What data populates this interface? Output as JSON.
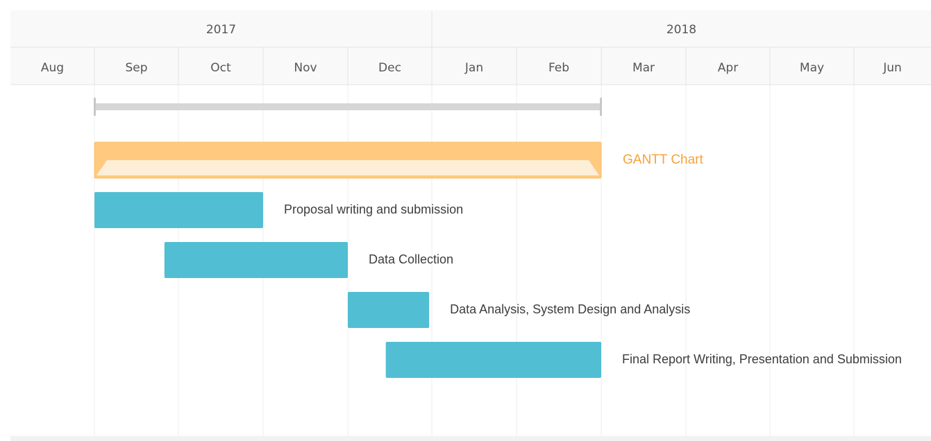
{
  "chart_data": {
    "type": "gantt",
    "years": [
      {
        "label": "2017",
        "start": "2017-08-01",
        "end": "2018-01-01"
      },
      {
        "label": "2018",
        "start": "2018-01-01",
        "end": "2018-07-01"
      }
    ],
    "months": [
      {
        "label": "Aug",
        "start": "2017-08-01"
      },
      {
        "label": "Sep",
        "start": "2017-09-01"
      },
      {
        "label": "Oct",
        "start": "2017-10-01"
      },
      {
        "label": "Nov",
        "start": "2017-11-01"
      },
      {
        "label": "Dec",
        "start": "2017-12-01"
      },
      {
        "label": "Jan",
        "start": "2018-01-01"
      },
      {
        "label": "Feb",
        "start": "2018-02-01"
      },
      {
        "label": "Mar",
        "start": "2018-03-01"
      },
      {
        "label": "Apr",
        "start": "2018-04-01"
      },
      {
        "label": "May",
        "start": "2018-05-01"
      },
      {
        "label": "Jun",
        "start": "2018-06-01"
      }
    ],
    "range": {
      "start": "2017-09-01",
      "end": "2018-03-01"
    },
    "summary": {
      "name": "GANTT Chart",
      "start": "2017-09-01",
      "end": "2018-03-01",
      "color": "#ffc980"
    },
    "tasks": [
      {
        "name": "Proposal writing and submission",
        "start": "2017-09-01",
        "end": "2017-11-01"
      },
      {
        "name": "Data Collection",
        "start": "2017-09-26",
        "end": "2017-12-01"
      },
      {
        "name": "Data Analysis, System Design and Analysis",
        "start": "2017-12-01",
        "end": "2017-12-31"
      },
      {
        "name": "Final Report Writing, Presentation and Submission",
        "start": "2017-12-15",
        "end": "2018-03-01"
      }
    ],
    "grid": true,
    "colors": {
      "task": "#52bed3",
      "summary": "#ffc980",
      "summary_label": "#f7a23b",
      "range": "#d6d6d6"
    }
  }
}
